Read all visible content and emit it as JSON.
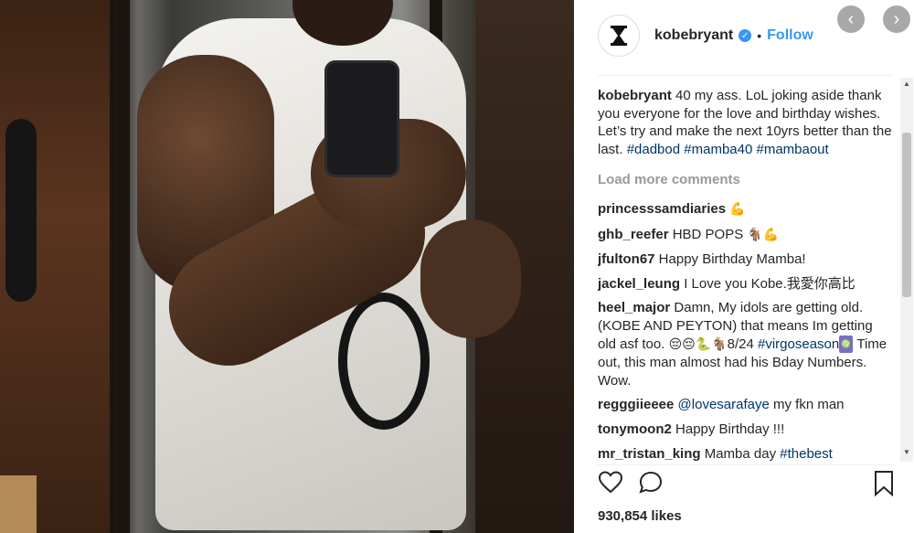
{
  "post": {
    "username": "kobebryant",
    "follow_label": "Follow",
    "dot": "•"
  },
  "caption": {
    "user": "kobebryant",
    "text_before": "40 my ass. LoL joking aside thank you everyone for the love and birthday wishes. Let’s try and make the next 10yrs better than the last. ",
    "tags": [
      "#dadbod",
      "#mamba40",
      "#mambaout"
    ]
  },
  "load_more_label": "Load more comments",
  "comments": [
    {
      "user": "princesssamdiaries",
      "text": "",
      "emoji": "💪"
    },
    {
      "user": "ghb_reefer",
      "text": "HBD POPS",
      "emoji": "🐐💪"
    },
    {
      "user": "jfulton67",
      "text": "Happy Birthday Mamba!",
      "emoji": ""
    },
    {
      "user": "jackel_leung",
      "text": "I Love you Kobe.我愛你高比",
      "emoji": ""
    },
    {
      "user": "heel_major",
      "text": "Damn, My idols are getting old. (KOBE AND PEYTON) that means Im getting old asf too.",
      "emoji": "😔😔🐍🐐",
      "tail": "8/24",
      "tag": "#virgoseason",
      "badge": "♍",
      "text2": "Time out, this man almost had his Bday Numbers. Wow."
    },
    {
      "user": "regggiieeee",
      "mention": "@lovesarafaye",
      "text": "my fkn man",
      "emoji": ""
    },
    {
      "user": "tonymoon2",
      "text": "Happy Birthday !!!",
      "emoji": ""
    },
    {
      "user": "mr_tristan_king",
      "text": "Mamba day",
      "tag": "#thebest",
      "emoji": ""
    }
  ],
  "likes": "930,854 likes",
  "icons": {
    "avatar": "hourglass-logo-icon",
    "verified": "verified-badge-icon",
    "prev": "chevron-left-icon",
    "next": "chevron-right-icon",
    "like": "heart-icon",
    "comment": "comment-bubble-icon",
    "save": "bookmark-icon"
  },
  "colors": {
    "link_blue": "#3897f0",
    "hashtag": "#003569",
    "muted": "#999999"
  },
  "nav": {
    "prev": "‹",
    "next": "›"
  }
}
